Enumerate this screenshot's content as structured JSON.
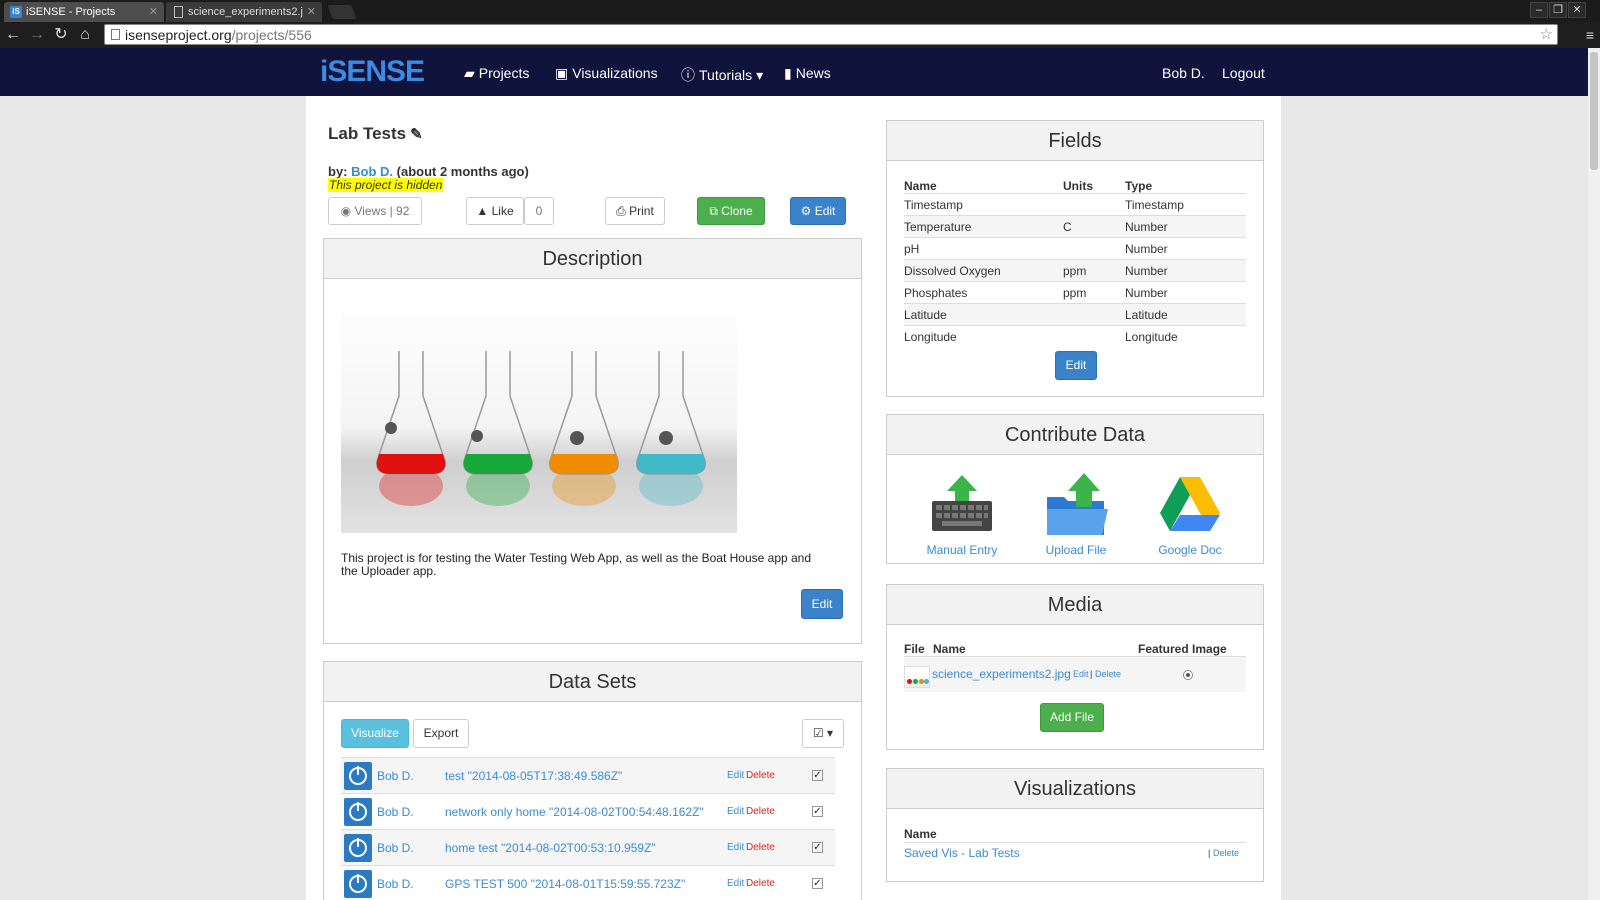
{
  "browser": {
    "tabs": [
      {
        "title": "iSENSE - Projects",
        "active": true
      },
      {
        "title": "science_experiments2.j",
        "active": false
      }
    ],
    "url_host": "isenseproject.org",
    "url_path": "/projects/556"
  },
  "nav": {
    "logo": "iSENSE",
    "links": [
      "Projects",
      "Visualizations",
      "Tutorials",
      "News"
    ],
    "user": "Bob D.",
    "logout": "Logout"
  },
  "project": {
    "title": "Lab Tests",
    "by_label": "by:",
    "author": "Bob D.",
    "age": "(about 2 months ago)",
    "hidden_note": "This project is hidden",
    "views": "Views | 92",
    "like_label": "Like",
    "like_count": "0",
    "print_label": "Print",
    "clone_label": "Clone",
    "edit_label": "Edit"
  },
  "description": {
    "heading": "Description",
    "text": "This project is for testing the Water Testing Web App, as well as the Boat House app and the Uploader app.",
    "edit_label": "Edit"
  },
  "datasets": {
    "heading": "Data Sets",
    "visualize_label": "Visualize",
    "export_label": "Export",
    "rows": [
      {
        "user": "Bob D.",
        "name": "test \"2014-08-05T17:38:49.586Z\"",
        "edit": "Edit",
        "delete": "Delete"
      },
      {
        "user": "Bob D.",
        "name": "network only home \"2014-08-02T00:54:48.162Z\"",
        "edit": "Edit",
        "delete": "Delete"
      },
      {
        "user": "Bob D.",
        "name": "home test \"2014-08-02T00:53:10.959Z\"",
        "edit": "Edit",
        "delete": "Delete"
      },
      {
        "user": "Bob D.",
        "name": "GPS TEST 500 \"2014-08-01T15:59:55.723Z\"",
        "edit": "Edit",
        "delete": "Delete"
      }
    ]
  },
  "fields": {
    "heading": "Fields",
    "headers": [
      "Name",
      "Units",
      "Type"
    ],
    "rows": [
      [
        "Timestamp",
        "",
        "Timestamp"
      ],
      [
        "Temperature",
        "C",
        "Number"
      ],
      [
        "pH",
        "",
        "Number"
      ],
      [
        "Dissolved Oxygen",
        "ppm",
        "Number"
      ],
      [
        "Phosphates",
        "ppm",
        "Number"
      ],
      [
        "Latitude",
        "",
        "Latitude"
      ],
      [
        "Longitude",
        "",
        "Longitude"
      ]
    ],
    "edit_label": "Edit"
  },
  "contribute": {
    "heading": "Contribute Data",
    "items": [
      "Manual Entry",
      "Upload File",
      "Google Doc"
    ]
  },
  "media": {
    "heading": "Media",
    "headers": [
      "File",
      "Name",
      "Featured Image"
    ],
    "file_name": "science_experiments2.jpg",
    "edit": "Edit",
    "delete": "Delete",
    "add_label": "Add File"
  },
  "visualizations": {
    "heading": "Visualizations",
    "header": "Name",
    "item": "Saved Vis - Lab Tests",
    "delete": "Delete"
  },
  "colors": {
    "nav_bg": "#10133c",
    "link": "#3b8bd0",
    "primary": "#3a82c9",
    "success": "#4cae4c",
    "info": "#5bc0de",
    "danger": "#d9261c",
    "highlight": "#ffff00"
  }
}
